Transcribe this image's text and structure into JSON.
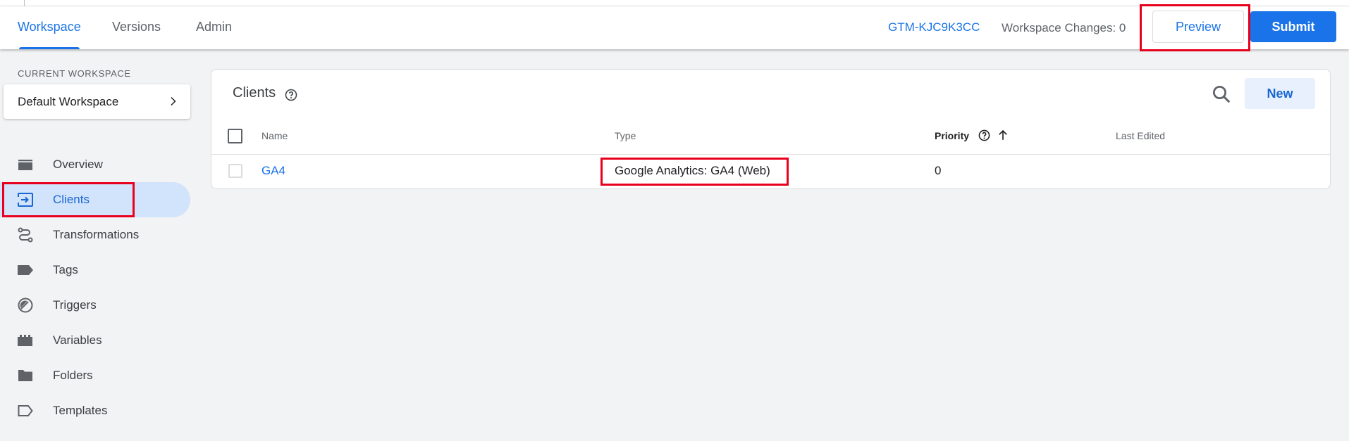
{
  "header": {
    "tabs": [
      {
        "label": "Workspace",
        "active": true
      },
      {
        "label": "Versions",
        "active": false
      },
      {
        "label": "Admin",
        "active": false
      }
    ],
    "container_id": "GTM-KJC9K3CC",
    "workspace_changes": "Workspace Changes: 0",
    "preview_label": "Preview",
    "submit_label": "Submit"
  },
  "sidebar": {
    "workspace_label": "CURRENT WORKSPACE",
    "workspace_name": "Default Workspace",
    "items": [
      {
        "label": "Overview",
        "icon": "overview-icon",
        "active": false
      },
      {
        "label": "Clients",
        "icon": "clients-icon",
        "active": true
      },
      {
        "label": "Transformations",
        "icon": "transformations-icon",
        "active": false
      },
      {
        "label": "Tags",
        "icon": "tag-icon",
        "active": false
      },
      {
        "label": "Triggers",
        "icon": "trigger-icon",
        "active": false
      },
      {
        "label": "Variables",
        "icon": "variables-icon",
        "active": false
      },
      {
        "label": "Folders",
        "icon": "folder-icon",
        "active": false
      },
      {
        "label": "Templates",
        "icon": "template-icon",
        "active": false
      }
    ]
  },
  "main": {
    "title": "Clients",
    "new_label": "New",
    "columns": [
      "Name",
      "Type",
      "Priority",
      "Last Edited"
    ],
    "rows": [
      {
        "name": "GA4",
        "type": "Google Analytics: GA4 (Web)",
        "priority": "0",
        "last_edited": ""
      }
    ]
  },
  "colors": {
    "accent": "#1a73e8",
    "highlight": "#e8001c",
    "active_nav_bg": "#d2e3fc"
  }
}
